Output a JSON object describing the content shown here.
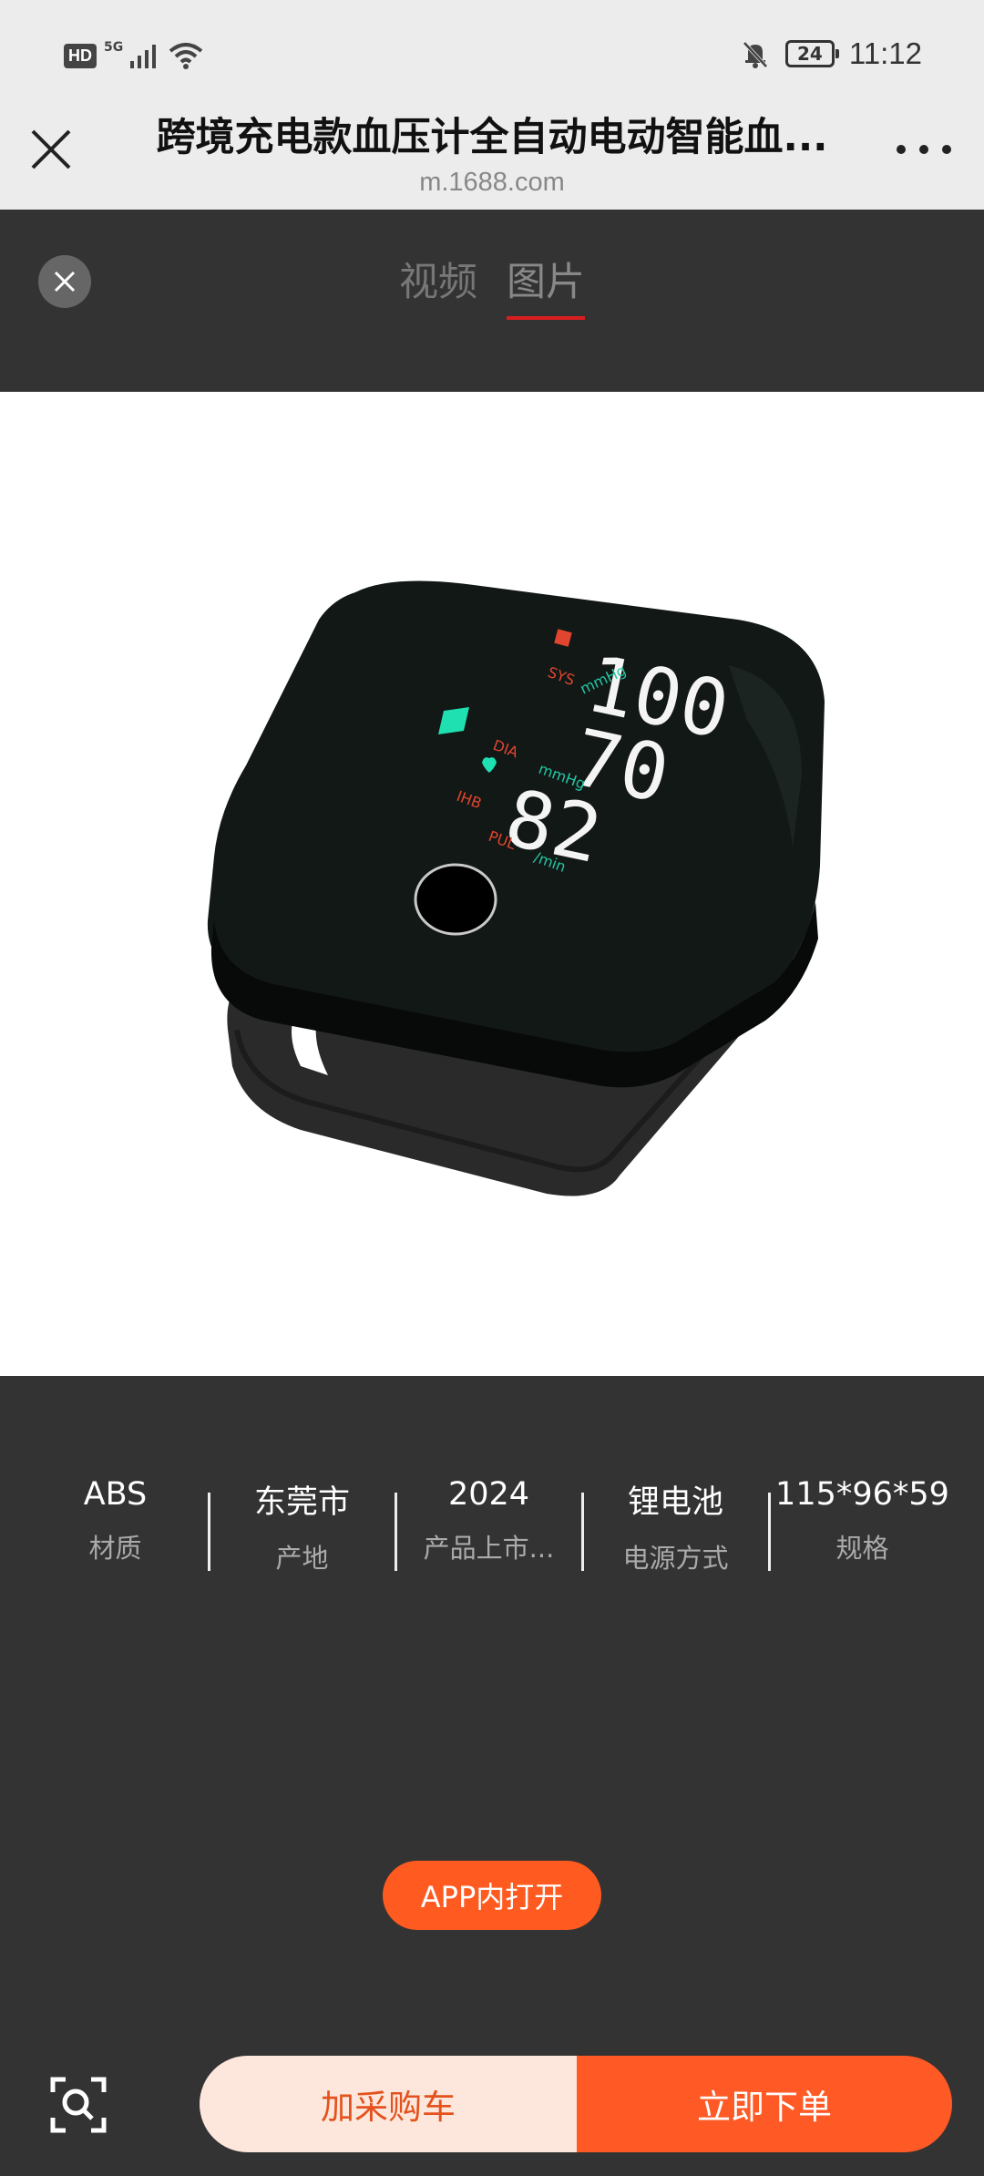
{
  "status_bar": {
    "hd": "HD",
    "network": "5G",
    "battery": "24",
    "time": "11:12",
    "icons": [
      "hd-icon",
      "signal-icon",
      "wifi-icon",
      "mute-bell-icon",
      "battery-icon"
    ]
  },
  "header": {
    "title": "跨境充电款血压计全自动电动智能血...",
    "url": "m.1688.com",
    "icons": [
      "close-icon",
      "more-icon"
    ]
  },
  "viewer": {
    "tabs": [
      {
        "label": "视频",
        "active": false
      },
      {
        "label": "图片",
        "active": true
      }
    ],
    "accent_color": "#d81e1e"
  },
  "product_image": {
    "sys": "100",
    "dia": "70",
    "pul": "82",
    "label_sys": "SYS",
    "label_dia": "DIA",
    "label_pul": "PUL",
    "label_ihb": "IHB",
    "unit_mmhg": "mmHg",
    "unit_min": "/min"
  },
  "specs": [
    {
      "value": "ABS",
      "label": "材质"
    },
    {
      "value": "东莞市",
      "label": "产地"
    },
    {
      "value": "2024",
      "label": "产品上市..."
    },
    {
      "value": "锂电池",
      "label": "电源方式"
    },
    {
      "value": "115*96*59",
      "label": "规格"
    }
  ],
  "actions": {
    "open_app": "APP内打开",
    "add_cart": "加采购车",
    "buy_now": "立即下单",
    "brand_color": "#ff5a25"
  }
}
